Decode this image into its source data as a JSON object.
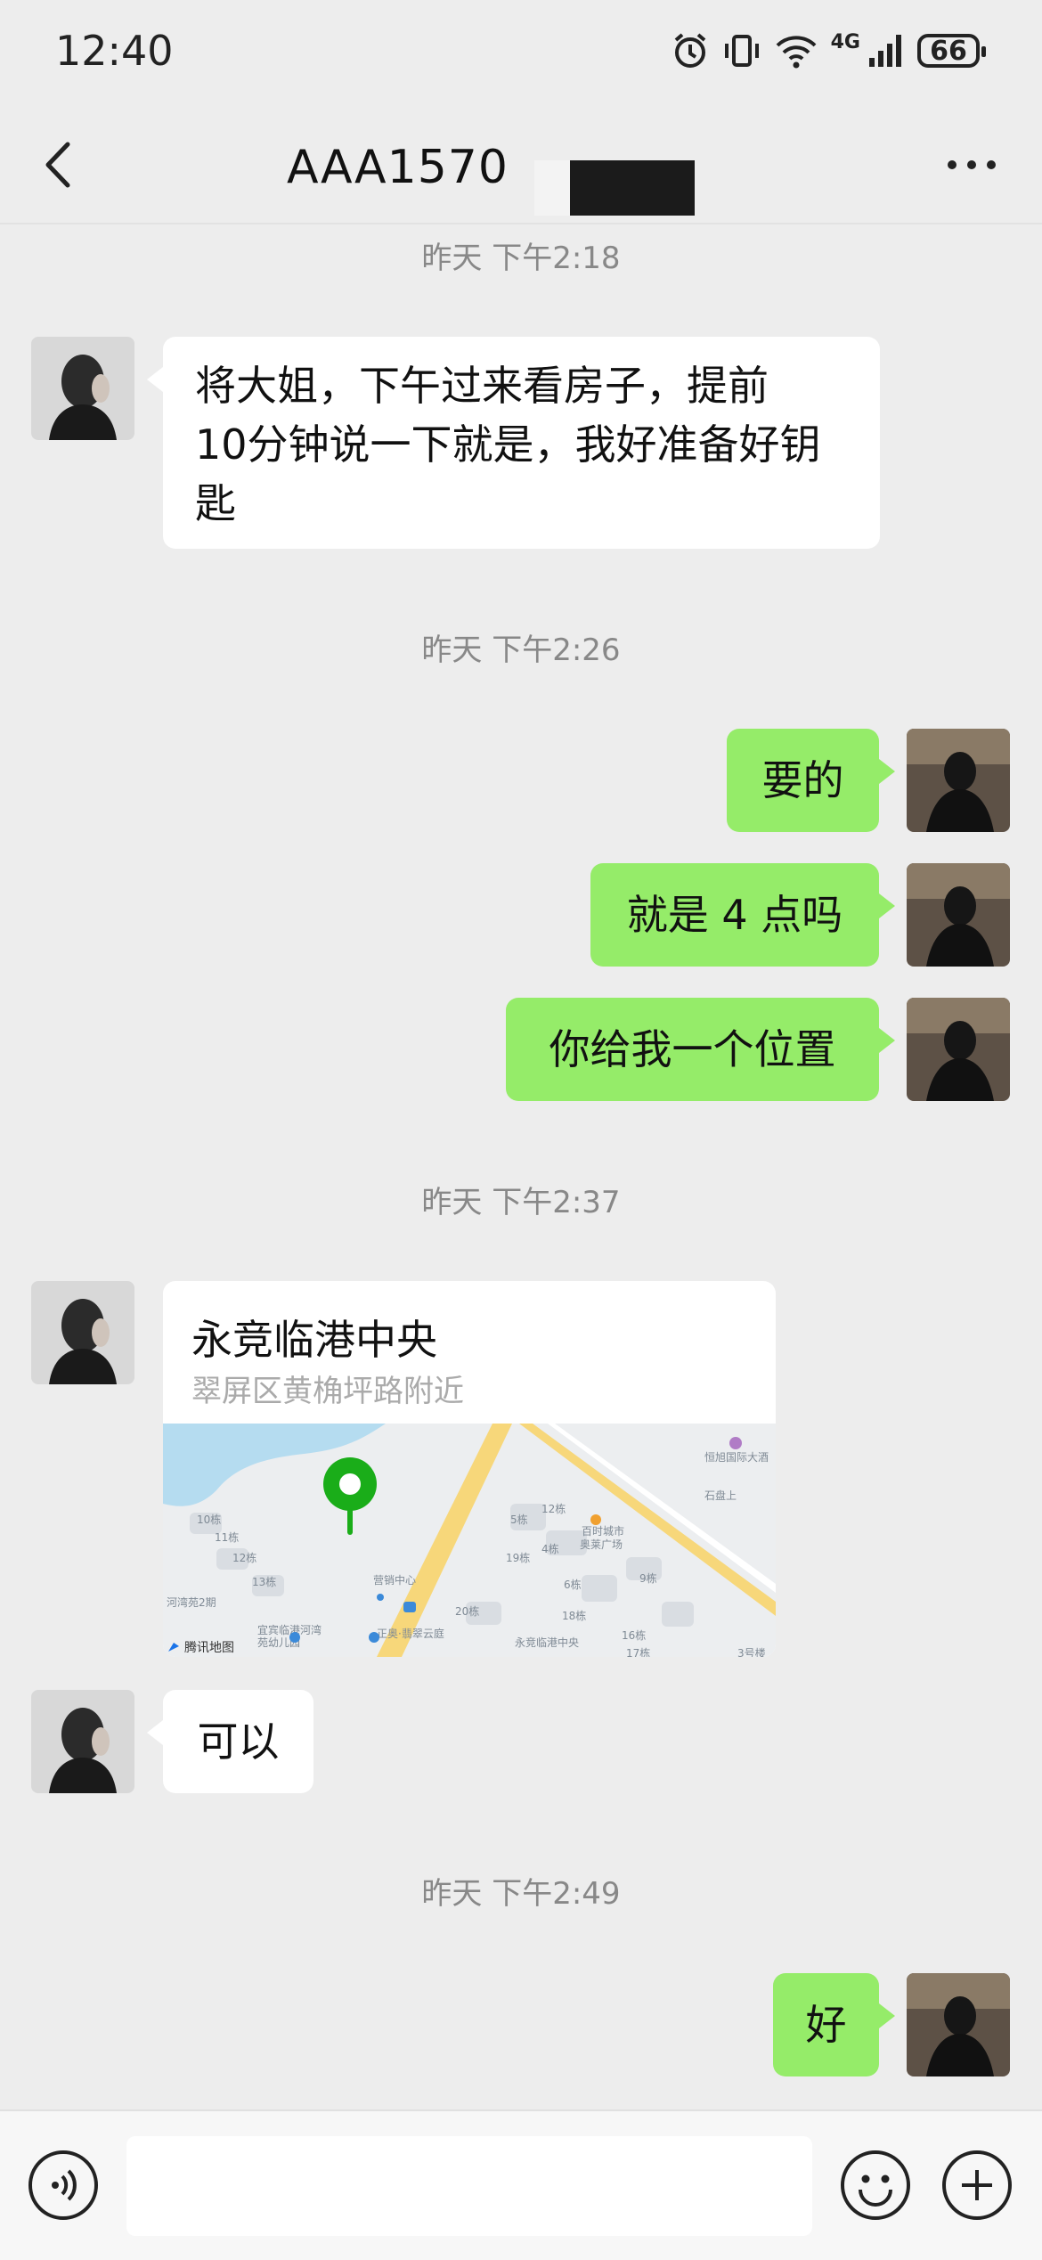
{
  "status_bar": {
    "time": "12:40",
    "icons": [
      "alarm-icon",
      "vibrate-icon",
      "wifi-icon",
      "4g-signal-icon"
    ],
    "network": "4G",
    "battery": "66"
  },
  "header": {
    "title": "AAA1570",
    "back_icon": "chevron-left-icon",
    "more_icon": "more-dots-icon"
  },
  "messages": [
    {
      "type": "time",
      "text": "昨天 下午2:18"
    },
    {
      "type": "text",
      "side": "in",
      "lines": [
        "将大姐，下午过来看房子，提前",
        "10分钟说一下就是，我好准备好钥",
        "匙"
      ]
    },
    {
      "type": "time",
      "text": "昨天 下午2:26"
    },
    {
      "type": "text",
      "side": "out",
      "text": "要的"
    },
    {
      "type": "text",
      "side": "out",
      "text": "就是 4 点吗"
    },
    {
      "type": "text",
      "side": "out",
      "text": "你给我一个位置"
    },
    {
      "type": "time",
      "text": "昨天 下午2:37"
    },
    {
      "type": "location",
      "side": "in",
      "name": "永竞临港中央",
      "address": "翠屏区黄桷坪路附近",
      "map_labels": [
        "恒旭国际大酒",
        "石盘上",
        "百时城市",
        "奥莱广场",
        "营销中心",
        "10栋",
        "11栋",
        "12栋",
        "13栋",
        "河湾苑2期",
        "宜宾临港河湾",
        "苑幼儿园",
        "正奥·翡翠云庭",
        "永竞临港中央",
        "5栋",
        "12栋",
        "4栋",
        "19栋",
        "6栋",
        "9栋",
        "18栋",
        "20栋",
        "16栋",
        "17栋",
        "3号楼",
        "腾讯地图"
      ]
    },
    {
      "type": "text",
      "side": "in",
      "text": "可以"
    },
    {
      "type": "time",
      "text": "昨天 下午2:49"
    },
    {
      "type": "text",
      "side": "out",
      "text": "好"
    }
  ],
  "input_bar": {
    "voice_icon": "voice-icon",
    "emoji_icon": "emoji-icon",
    "plus_icon": "plus-icon"
  },
  "colors": {
    "background": "#ededed",
    "outgoing_bubble": "#95ec69",
    "incoming_bubble": "#ffffff",
    "map_pin": "#1aad19"
  }
}
